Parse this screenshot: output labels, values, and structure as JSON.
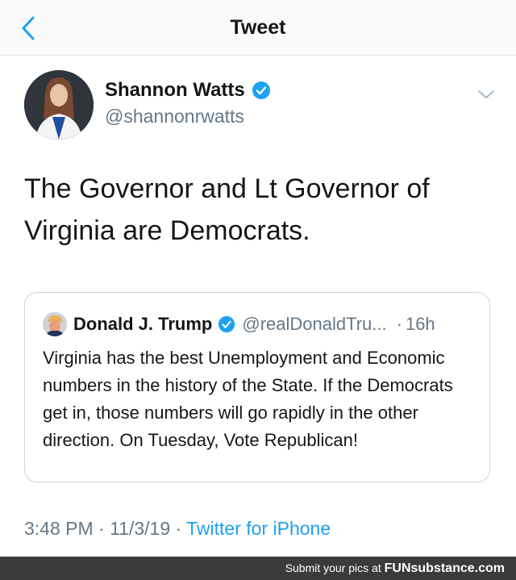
{
  "header": {
    "title": "Tweet",
    "back_icon": "chevron-left-icon"
  },
  "tweet": {
    "author_name": "Shannon Watts",
    "author_handle": "@shannonrwatts",
    "text_line1": "The Governor and Lt Governor of",
    "text_line2": "Virginia are Democrats.",
    "timestamp": "3:48 PM · 11/3/19 · ",
    "source": "Twitter for iPhone"
  },
  "quote": {
    "author_name": "Donald J. Trump",
    "author_handle": "@realDonaldTru...",
    "separator": "·",
    "time": "16h",
    "text": "Virginia has the best Unemployment and Economic numbers in the history of the State. If the Democrats get in, those numbers will go rapidly in the other direction. On Tuesday, Vote Republican!"
  },
  "footer": {
    "text": "Submit your pics at ",
    "brand": "FUNsubstance.com"
  },
  "colors": {
    "link": "#1da1f2",
    "verified": "#1da1f2",
    "muted": "#657786",
    "footer_bg": "#3b3b3b"
  }
}
